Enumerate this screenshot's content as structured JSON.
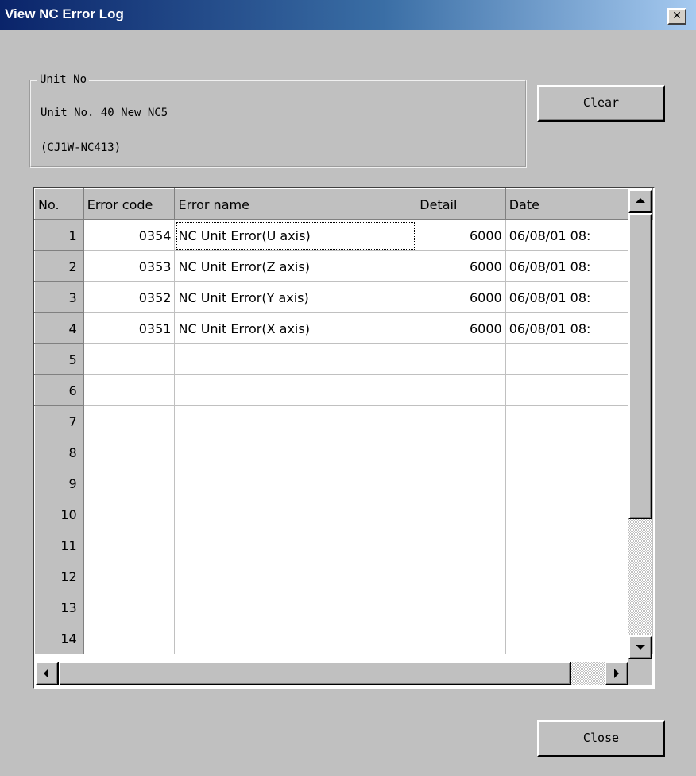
{
  "window": {
    "title": "View NC Error Log",
    "close_glyph": "✕"
  },
  "unit_group": {
    "legend": "Unit No",
    "line1": "Unit No. 40 New NC5",
    "line2": "(CJ1W-NC413)"
  },
  "buttons": {
    "clear": "Clear",
    "close": "Close"
  },
  "table": {
    "columns": [
      "No.",
      "Error code",
      "Error name",
      "Detail",
      "Date"
    ],
    "rows": [
      {
        "no": "1",
        "code": "0354",
        "name": "NC Unit Error(U axis)",
        "detail": "6000",
        "date": "06/08/01 08:"
      },
      {
        "no": "2",
        "code": "0353",
        "name": "NC Unit Error(Z axis)",
        "detail": "6000",
        "date": "06/08/01 08:"
      },
      {
        "no": "3",
        "code": "0352",
        "name": "NC Unit Error(Y axis)",
        "detail": "6000",
        "date": "06/08/01 08:"
      },
      {
        "no": "4",
        "code": "0351",
        "name": "NC Unit Error(X axis)",
        "detail": "6000",
        "date": "06/08/01 08:"
      },
      {
        "no": "5",
        "code": "",
        "name": "",
        "detail": "",
        "date": ""
      },
      {
        "no": "6",
        "code": "",
        "name": "",
        "detail": "",
        "date": ""
      },
      {
        "no": "7",
        "code": "",
        "name": "",
        "detail": "",
        "date": ""
      },
      {
        "no": "8",
        "code": "",
        "name": "",
        "detail": "",
        "date": ""
      },
      {
        "no": "9",
        "code": "",
        "name": "",
        "detail": "",
        "date": ""
      },
      {
        "no": "10",
        "code": "",
        "name": "",
        "detail": "",
        "date": ""
      },
      {
        "no": "11",
        "code": "",
        "name": "",
        "detail": "",
        "date": ""
      },
      {
        "no": "12",
        "code": "",
        "name": "",
        "detail": "",
        "date": ""
      },
      {
        "no": "13",
        "code": "",
        "name": "",
        "detail": "",
        "date": ""
      },
      {
        "no": "14",
        "code": "",
        "name": "",
        "detail": "",
        "date": ""
      }
    ]
  },
  "colors": {
    "title_gradient_start": "#0a246a",
    "face": "#c0c0c0"
  }
}
